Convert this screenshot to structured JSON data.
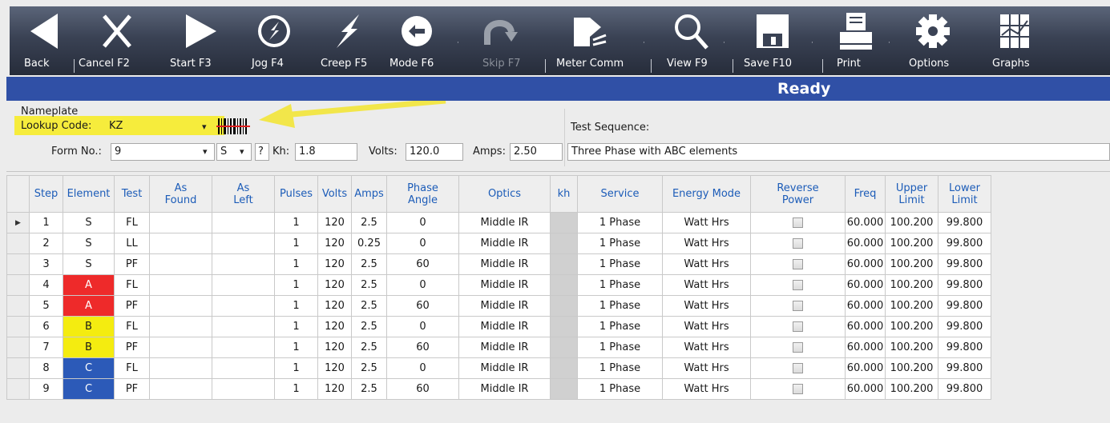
{
  "toolbar": {
    "back": "Back",
    "cancel": "Cancel F2",
    "start": "Start F3",
    "jog": "Jog F4",
    "creep": "Creep F5",
    "mode": "Mode F6",
    "skip": "Skip F7",
    "meter_comm": "Meter Comm",
    "view": "View F9",
    "save": "Save F10",
    "print": "Print",
    "options": "Options",
    "graphs": "Graphs"
  },
  "status": {
    "text": "Ready"
  },
  "nameplate": {
    "group_label": "Nameplate",
    "lookup_label": "Lookup Code:",
    "lookup_value": "KZ",
    "form_label": "Form No.:",
    "form_value": "9",
    "s_value": "S",
    "help_label": "?",
    "kh_label": "Kh:",
    "kh_value": "1.8",
    "volts_label": "Volts:",
    "volts_value": "120.0",
    "amps_label": "Amps:",
    "amps_value": "2.50"
  },
  "test_sequence": {
    "label": "Test Sequence:",
    "value": "Three Phase with ABC elements"
  },
  "table": {
    "headers": {
      "step": "Step",
      "element": "Element",
      "test": "Test",
      "as_found_1": "As",
      "as_found_2": "Found",
      "as_left_1": "As",
      "as_left_2": "Left",
      "pulses": "Pulses",
      "volts": "Volts",
      "amps": "Amps",
      "phase_1": "Phase",
      "phase_2": "Angle",
      "optics": "Optics",
      "kh": "kh",
      "service": "Service",
      "energy_mode": "Energy Mode",
      "reverse_1": "Reverse",
      "reverse_2": "Power",
      "freq": "Freq",
      "upper_1": "Upper",
      "upper_2": "Limit",
      "lower_1": "Lower",
      "lower_2": "Limit"
    },
    "rows": [
      {
        "step": "1",
        "element": "S",
        "test": "FL",
        "pulses": "1",
        "volts": "120",
        "amps": "2.5",
        "phase": "0",
        "optics": "Middle IR",
        "service": "1 Phase",
        "energy": "Watt Hrs",
        "freq": "60.000",
        "upper": "100.200",
        "lower": "99.800"
      },
      {
        "step": "2",
        "element": "S",
        "test": "LL",
        "pulses": "1",
        "volts": "120",
        "amps": "0.25",
        "phase": "0",
        "optics": "Middle IR",
        "service": "1 Phase",
        "energy": "Watt Hrs",
        "freq": "60.000",
        "upper": "100.200",
        "lower": "99.800"
      },
      {
        "step": "3",
        "element": "S",
        "test": "PF",
        "pulses": "1",
        "volts": "120",
        "amps": "2.5",
        "phase": "60",
        "optics": "Middle IR",
        "service": "1 Phase",
        "energy": "Watt Hrs",
        "freq": "60.000",
        "upper": "100.200",
        "lower": "99.800"
      },
      {
        "step": "4",
        "element": "A",
        "test": "FL",
        "pulses": "1",
        "volts": "120",
        "amps": "2.5",
        "phase": "0",
        "optics": "Middle IR",
        "service": "1 Phase",
        "energy": "Watt Hrs",
        "freq": "60.000",
        "upper": "100.200",
        "lower": "99.800"
      },
      {
        "step": "5",
        "element": "A",
        "test": "PF",
        "pulses": "1",
        "volts": "120",
        "amps": "2.5",
        "phase": "60",
        "optics": "Middle IR",
        "service": "1 Phase",
        "energy": "Watt Hrs",
        "freq": "60.000",
        "upper": "100.200",
        "lower": "99.800"
      },
      {
        "step": "6",
        "element": "B",
        "test": "FL",
        "pulses": "1",
        "volts": "120",
        "amps": "2.5",
        "phase": "0",
        "optics": "Middle IR",
        "service": "1 Phase",
        "energy": "Watt Hrs",
        "freq": "60.000",
        "upper": "100.200",
        "lower": "99.800"
      },
      {
        "step": "7",
        "element": "B",
        "test": "PF",
        "pulses": "1",
        "volts": "120",
        "amps": "2.5",
        "phase": "60",
        "optics": "Middle IR",
        "service": "1 Phase",
        "energy": "Watt Hrs",
        "freq": "60.000",
        "upper": "100.200",
        "lower": "99.800"
      },
      {
        "step": "8",
        "element": "C",
        "test": "FL",
        "pulses": "1",
        "volts": "120",
        "amps": "2.5",
        "phase": "0",
        "optics": "Middle IR",
        "service": "1 Phase",
        "energy": "Watt Hrs",
        "freq": "60.000",
        "upper": "100.200",
        "lower": "99.800"
      },
      {
        "step": "9",
        "element": "C",
        "test": "PF",
        "pulses": "1",
        "volts": "120",
        "amps": "2.5",
        "phase": "60",
        "optics": "Middle IR",
        "service": "1 Phase",
        "energy": "Watt Hrs",
        "freq": "60.000",
        "upper": "100.200",
        "lower": "99.800"
      }
    ]
  },
  "colors": {
    "element_a": "#ee2a2a",
    "element_b": "#f4ec10",
    "element_c": "#2c5ab8",
    "status_bar": "#3050a6",
    "highlight": "#f6ec3c"
  },
  "icons": {
    "back": "back-arrow-icon",
    "cancel": "x-icon",
    "start": "play-icon",
    "jog": "jog-lightning-circle-icon",
    "creep": "lightning-icon",
    "mode": "mode-circle-icon",
    "skip": "skip-curved-arrow-icon",
    "meter_comm": "meter-comm-icon",
    "view": "magnifier-icon",
    "save": "floppy-disk-icon",
    "print": "printer-icon",
    "options": "gear-icon",
    "graphs": "graph-grid-icon",
    "barcode": "barcode-icon",
    "row_marker": "row-selector-icon"
  }
}
